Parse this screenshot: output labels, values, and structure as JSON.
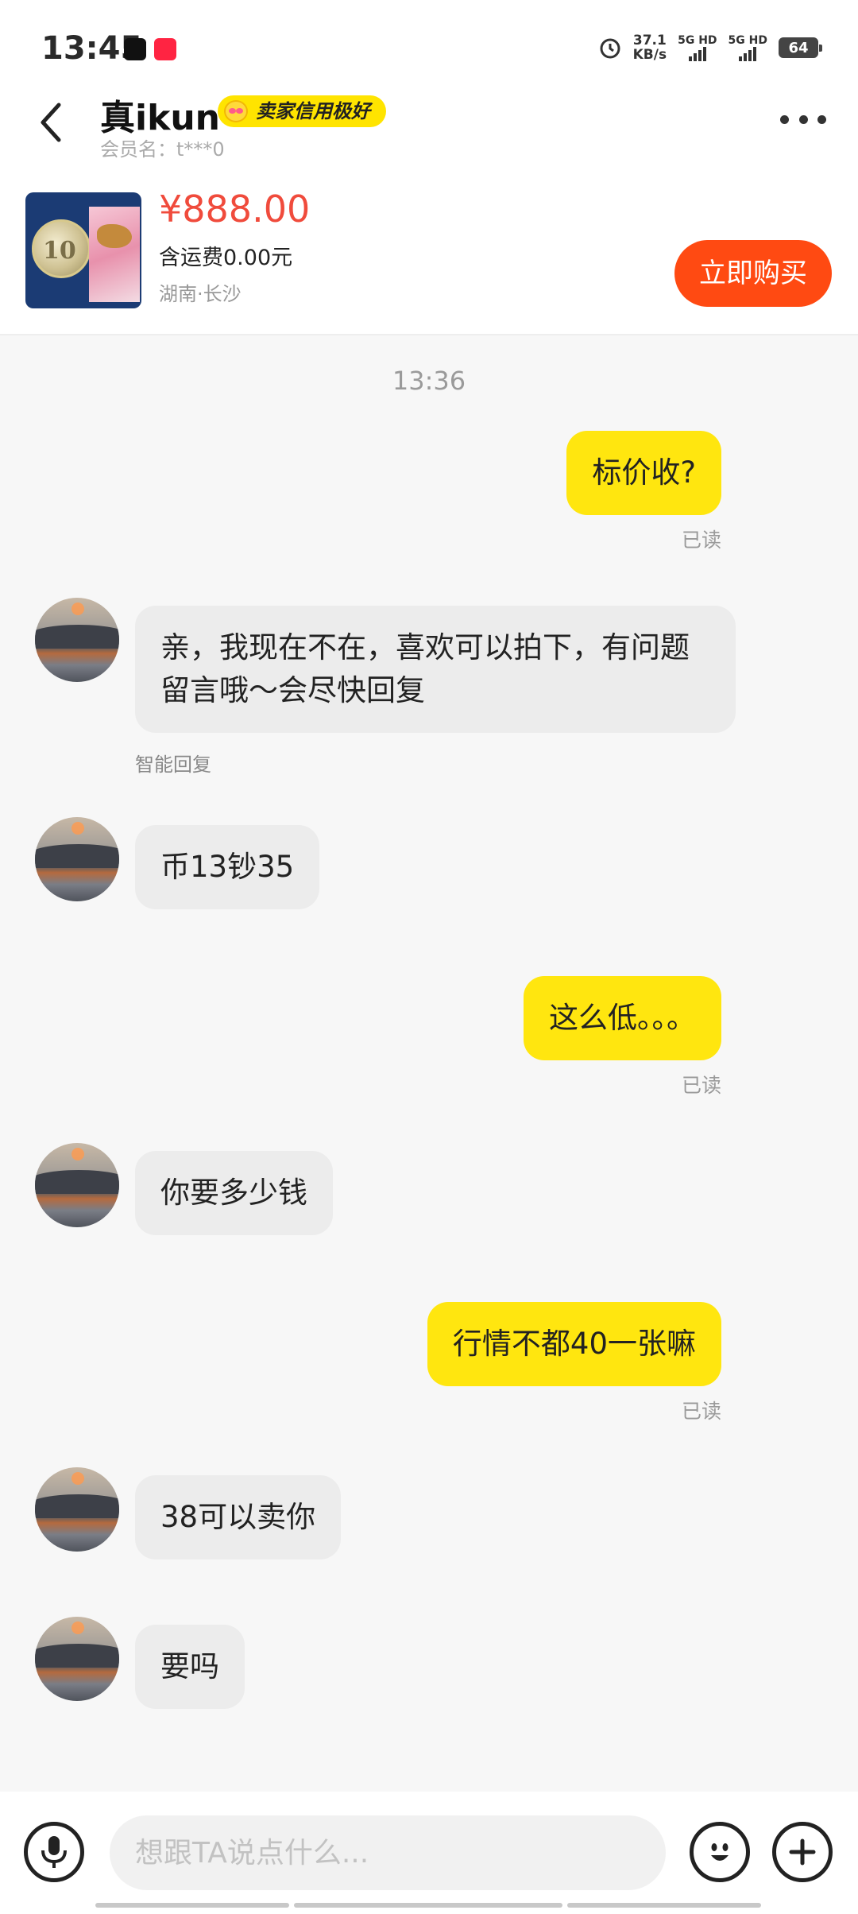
{
  "status_bar": {
    "time": "13:45",
    "net_speed_value": "37.1",
    "net_speed_unit": "KB/s",
    "sim1": "5G HD",
    "sim2": "5G HD",
    "battery": "64"
  },
  "header": {
    "seller_name": "真ikun",
    "credit_badge": "卖家信用极好",
    "member_label": "会员名：t***0"
  },
  "product": {
    "price": "¥888.00",
    "shipping": "含运费0.00元",
    "location": "湖南·长沙",
    "buy_button": "立即购买",
    "thumb_number": "10"
  },
  "chat": {
    "timestamp": "13:36",
    "messages": [
      {
        "side": "mine",
        "text": "标价收?",
        "status": "已读"
      },
      {
        "side": "theirs",
        "text": "亲，我现在不在，喜欢可以拍下，有问题留言哦～会尽快回复",
        "sublabel": "智能回复"
      },
      {
        "side": "theirs",
        "text": "币13钞35"
      },
      {
        "side": "mine",
        "text": "这么低。。。",
        "status": "已读"
      },
      {
        "side": "theirs",
        "text": "你要多少钱"
      },
      {
        "side": "mine",
        "text": "行情不都40一张嘛",
        "status": "已读"
      },
      {
        "side": "theirs",
        "text": "38可以卖你"
      },
      {
        "side": "theirs",
        "text": "要吗"
      }
    ]
  },
  "input_bar": {
    "placeholder": "想跟TA说点什么..."
  },
  "icons": {
    "back": "chevron-left-icon",
    "more": "more-dots-icon",
    "voice": "microphone-icon",
    "emoji": "emoji-icon",
    "add": "plus-icon"
  }
}
